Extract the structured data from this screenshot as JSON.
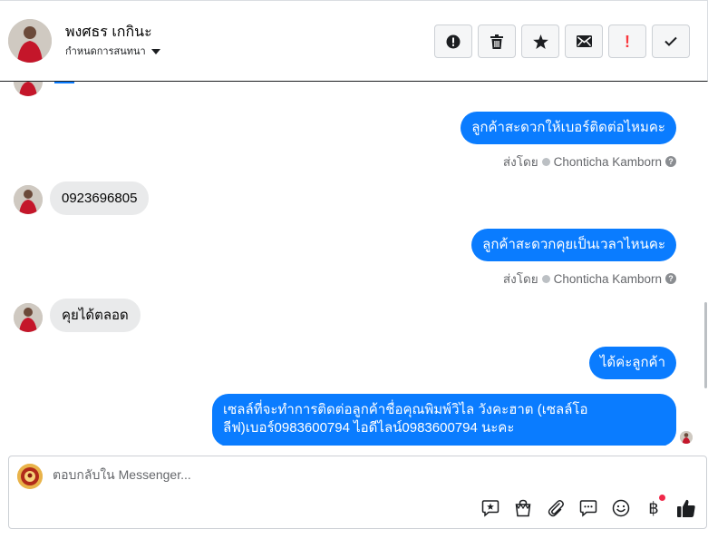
{
  "header": {
    "contact_name": "พงศธร เกกินะ",
    "assign_label": "กำหนดการสนทนา",
    "actions": [
      {
        "name": "report-button",
        "icon": "alert-circle-icon"
      },
      {
        "name": "trash-button",
        "icon": "trash-icon"
      },
      {
        "name": "star-button",
        "icon": "star-icon"
      },
      {
        "name": "mail-button",
        "icon": "envelope-icon"
      },
      {
        "name": "priority-button",
        "icon": "exclamation-icon"
      },
      {
        "name": "done-button",
        "icon": "checkmark-icon"
      }
    ],
    "priority_glyph": "!"
  },
  "thread": {
    "messages": [
      {
        "direction": "out",
        "text": "ลูกค้าสะดวกให้เบอร์ติดต่อไหมคะ"
      },
      {
        "direction": "in",
        "text": "0923696805"
      },
      {
        "direction": "out",
        "text": "ลูกค้าสะดวกคุยเป็นเวลาไหนคะ"
      },
      {
        "direction": "in",
        "text": "คุยได้ตลอด"
      },
      {
        "direction": "out",
        "text": "ได้ค่ะลูกค้า"
      },
      {
        "direction": "out",
        "text": "เซลล์ที่จะทำการติดต่อลูกค้าชื่อคุณพิมพ์วิไล วังคะฮาต (เซลล์โอลีฟ)เบอร์0983600794 ไอดีไลน์0983600794 นะคะ"
      }
    ],
    "sent_by_label": "ส่งโดย",
    "sender_name": "Chonticha Kamborn",
    "help_glyph": "?"
  },
  "composer": {
    "placeholder": "ตอบกลับใน Messenger...",
    "tools": [
      "saved-reply-icon",
      "shop-bag-icon",
      "paperclip-icon",
      "chat-bubble-icon",
      "smiley-icon",
      "baht-icon",
      "thumbs-up-icon"
    ],
    "baht_glyph": "฿"
  },
  "colors": {
    "outgoing_bubble": "#0a7cff",
    "incoming_bubble": "#e9eaeb",
    "notification_dot": "#f02849"
  }
}
